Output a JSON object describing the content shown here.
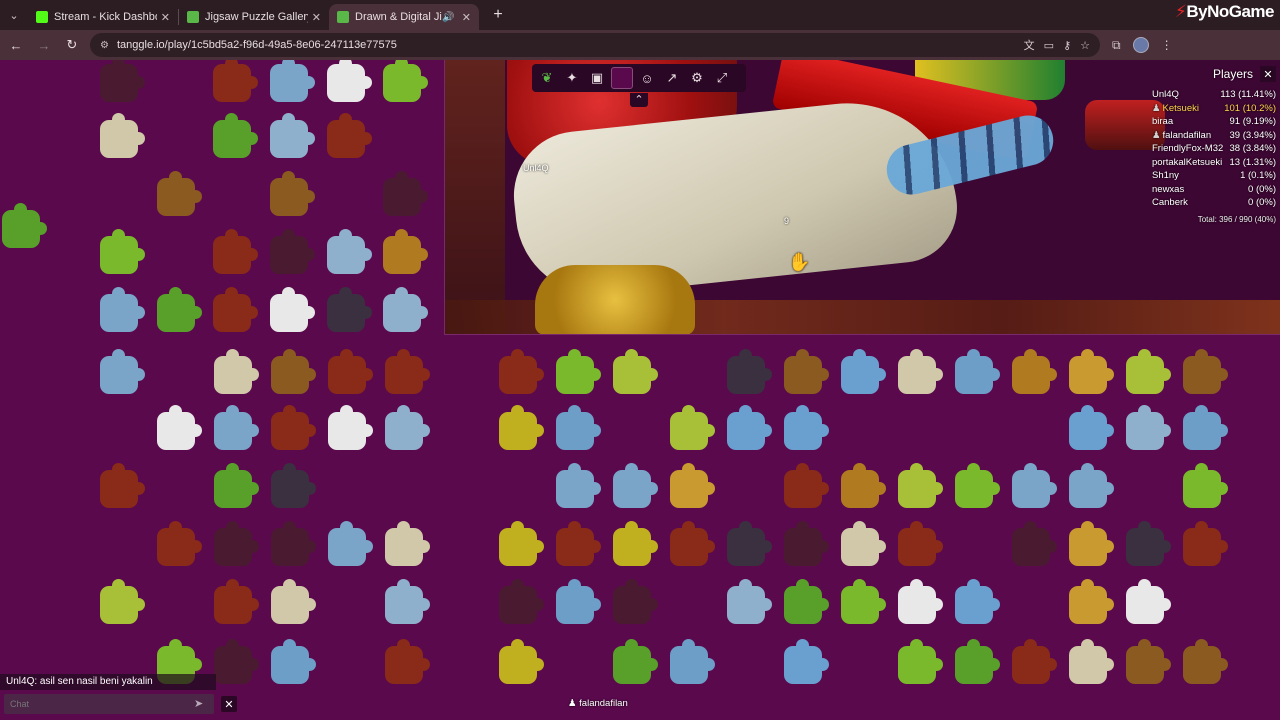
{
  "browser": {
    "tabs": [
      {
        "title": "Stream - Kick Dashboard",
        "favicon_color": "#53fc18",
        "active": false
      },
      {
        "title": "Jigsaw Puzzle Gallery",
        "favicon_color": "#5ab848",
        "active": false
      },
      {
        "title": "Drawn & Digital Jigsaw",
        "favicon_color": "#5ab848",
        "active": true
      }
    ],
    "url": "tanggle.io/play/1c5bd5a2-f96d-49a5-8e06-247113e77575",
    "brand": "ByNoGame"
  },
  "toolbar": {
    "tools": [
      "tanggle-logo-icon",
      "puzzle-piece-icon",
      "preview-image-icon",
      "background-color-swatch",
      "players-icon",
      "share-icon",
      "settings-gear-icon",
      "fullscreen-icon"
    ],
    "background_color": "#5a0a4c"
  },
  "players": {
    "title": "Players",
    "list": [
      {
        "name": "Unl4Q",
        "score": "113 (11.41%)",
        "icon": false,
        "highlight": false
      },
      {
        "name": "Ketsueki",
        "score": "101 (10.2%)",
        "icon": true,
        "highlight": true
      },
      {
        "name": "biraa",
        "score": "91 (9.19%)",
        "icon": false,
        "highlight": false
      },
      {
        "name": "falandafilan",
        "score": "39 (3.94%)",
        "icon": true,
        "highlight": false
      },
      {
        "name": "FriendlyFox-M32",
        "score": "38 (3.84%)",
        "icon": false,
        "highlight": false
      },
      {
        "name": "portakalKetsueki",
        "score": "13 (1.31%)",
        "icon": false,
        "highlight": false
      },
      {
        "name": "Sh1ny",
        "score": "1 (0.1%)",
        "icon": false,
        "highlight": false
      },
      {
        "name": "newxas",
        "score": "0 (0%)",
        "icon": false,
        "highlight": false
      },
      {
        "name": "Canberk",
        "score": "0 (0%)",
        "icon": false,
        "highlight": false
      }
    ],
    "total": "Total: 396 / 990 (40%)"
  },
  "cursors": {
    "unl4q": "Unl4Q",
    "piece_number": "9",
    "bottom_user": "falandafilan"
  },
  "chat": {
    "last_message": "Unl4Q: asil sen nasil beni yakalin",
    "placeholder": "Chat"
  }
}
